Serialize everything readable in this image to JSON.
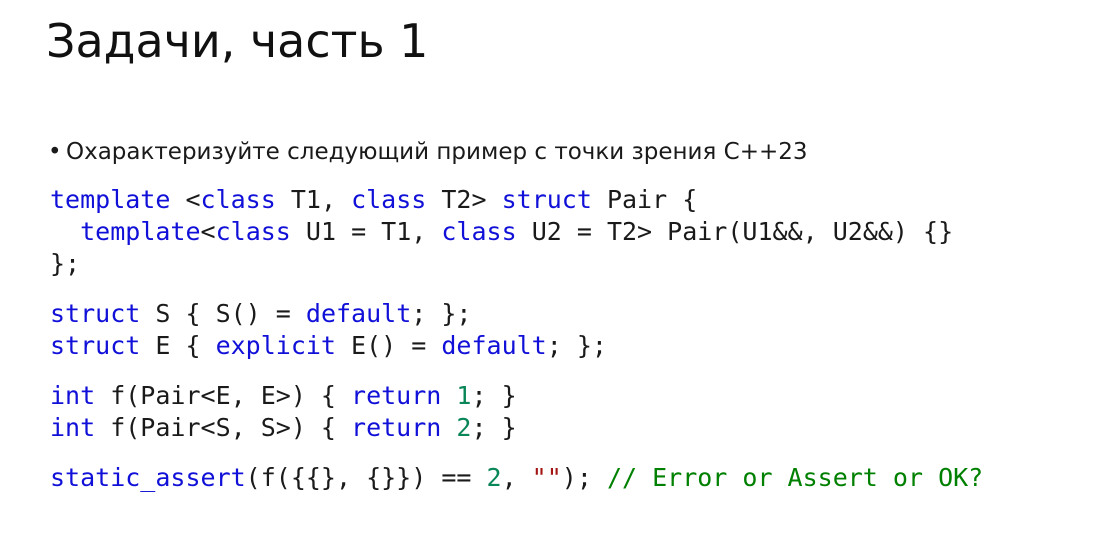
{
  "slide": {
    "title": "Задачи, часть 1",
    "bullet_char": "•",
    "bullet_text": "Охарактеризуйте следующий пример с точки зрения C++23"
  },
  "colors": {
    "keyword": "#1010d8",
    "number": "#098658",
    "string": "#a31515",
    "comment": "#008000",
    "text": "#1a1a1a"
  },
  "code_blocks": [
    {
      "lines": [
        [
          {
            "t": "kw",
            "v": "template"
          },
          {
            "t": "plain",
            "v": " <"
          },
          {
            "t": "kw",
            "v": "class"
          },
          {
            "t": "plain",
            "v": " T1, "
          },
          {
            "t": "kw",
            "v": "class"
          },
          {
            "t": "plain",
            "v": " T2> "
          },
          {
            "t": "kw",
            "v": "struct"
          },
          {
            "t": "plain",
            "v": " Pair {"
          }
        ],
        [
          {
            "t": "plain",
            "v": "  "
          },
          {
            "t": "kw",
            "v": "template"
          },
          {
            "t": "plain",
            "v": "<"
          },
          {
            "t": "kw",
            "v": "class"
          },
          {
            "t": "plain",
            "v": " U1 = T1, "
          },
          {
            "t": "kw",
            "v": "class"
          },
          {
            "t": "plain",
            "v": " U2 = T2> Pair(U1&&, U2&&) {}"
          }
        ],
        [
          {
            "t": "plain",
            "v": "};"
          }
        ]
      ]
    },
    {
      "lines": [
        [
          {
            "t": "kw",
            "v": "struct"
          },
          {
            "t": "plain",
            "v": " S { S() = "
          },
          {
            "t": "kw",
            "v": "default"
          },
          {
            "t": "plain",
            "v": "; };"
          }
        ],
        [
          {
            "t": "kw",
            "v": "struct"
          },
          {
            "t": "plain",
            "v": " E { "
          },
          {
            "t": "kw",
            "v": "explicit"
          },
          {
            "t": "plain",
            "v": " E() = "
          },
          {
            "t": "kw",
            "v": "default"
          },
          {
            "t": "plain",
            "v": "; };"
          }
        ]
      ]
    },
    {
      "lines": [
        [
          {
            "t": "kw",
            "v": "int"
          },
          {
            "t": "plain",
            "v": " f(Pair<E, E>) { "
          },
          {
            "t": "kw",
            "v": "return"
          },
          {
            "t": "plain",
            "v": " "
          },
          {
            "t": "num",
            "v": "1"
          },
          {
            "t": "plain",
            "v": "; }"
          }
        ],
        [
          {
            "t": "kw",
            "v": "int"
          },
          {
            "t": "plain",
            "v": " f(Pair<S, S>) { "
          },
          {
            "t": "kw",
            "v": "return"
          },
          {
            "t": "plain",
            "v": " "
          },
          {
            "t": "num",
            "v": "2"
          },
          {
            "t": "plain",
            "v": "; }"
          }
        ]
      ]
    },
    {
      "lines": [
        [
          {
            "t": "kw",
            "v": "static_assert"
          },
          {
            "t": "plain",
            "v": "(f({{}, {}}) == "
          },
          {
            "t": "num",
            "v": "2"
          },
          {
            "t": "plain",
            "v": ", "
          },
          {
            "t": "str",
            "v": "\"\""
          },
          {
            "t": "plain",
            "v": "); "
          },
          {
            "t": "com",
            "v": "// Error or Assert or OK?"
          }
        ]
      ]
    }
  ]
}
